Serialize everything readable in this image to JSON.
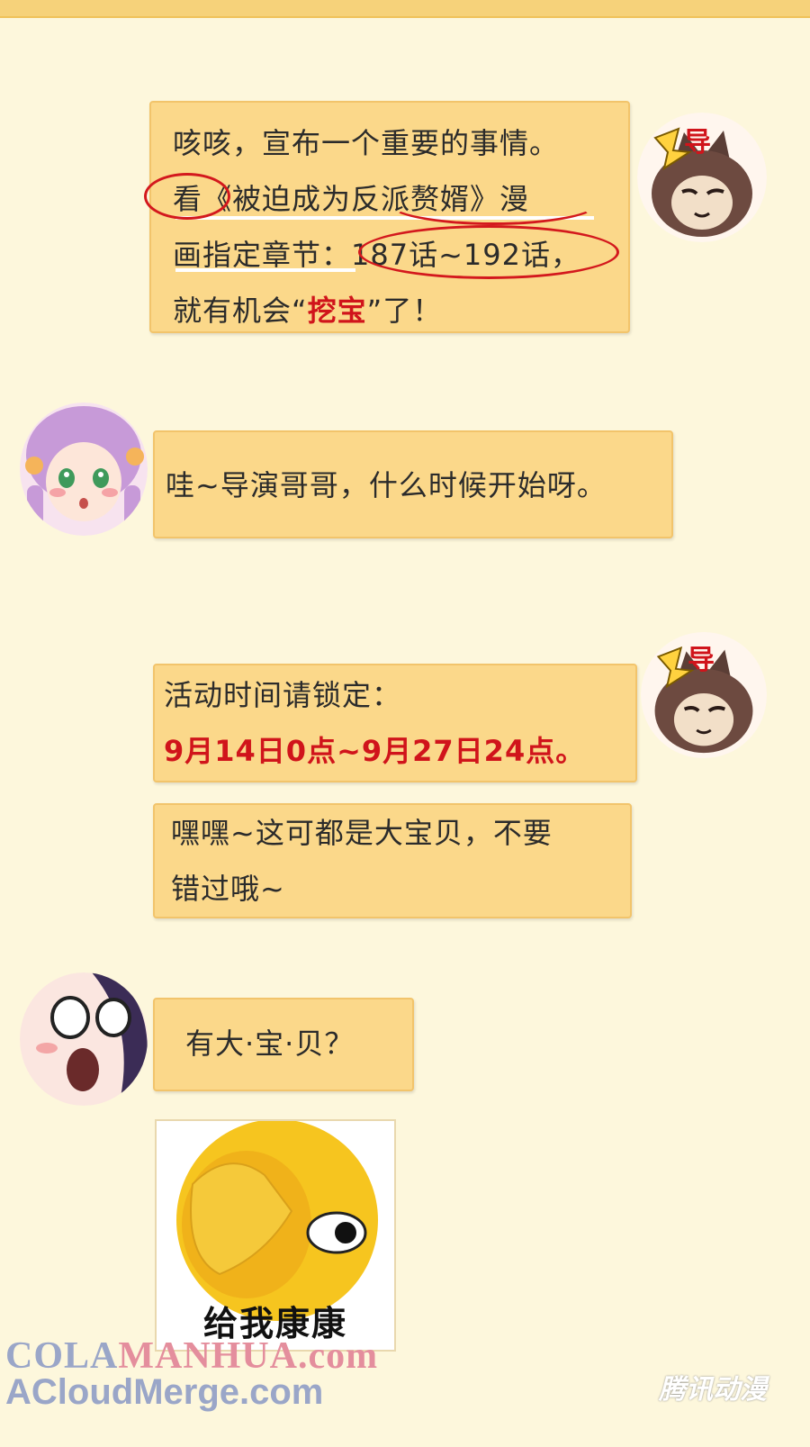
{
  "messages": [
    {
      "lines": [
        [
          {
            "t": "咳咳，宣布一个重要的事情。",
            "red": false
          }
        ],
        [
          {
            "t": "看《被迫成为反派赘婿》漫",
            "red": false
          }
        ],
        [
          {
            "t": "画指定章节：187话~192话，",
            "red": false
          }
        ],
        [
          {
            "t": "就有机会“",
            "red": false
          },
          {
            "t": "挖宝",
            "red": true
          },
          {
            "t": "”了！",
            "red": false
          }
        ]
      ]
    },
    {
      "lines": [
        [
          {
            "t": "哇~导演哥哥，什么时候开始呀。",
            "red": false
          }
        ]
      ]
    },
    {
      "lines": [
        [
          {
            "t": "活动时间请锁定：",
            "red": false
          }
        ],
        [
          {
            "t": "9月14日0点~9月27日24点。",
            "red": true
          }
        ]
      ]
    },
    {
      "lines": [
        [
          {
            "t": "嘿嘿~这可都是大宝贝，不要",
            "red": false
          }
        ],
        [
          {
            "t": "错过哦~",
            "red": false
          }
        ]
      ]
    },
    {
      "lines": [
        [
          {
            "t": "有大·宝·贝？",
            "red": false
          }
        ]
      ]
    }
  ],
  "avatars": {
    "director_badge": "导",
    "director_icon": "cat-avatar-icon",
    "girl_icon": "pink-hair-girl-avatar-icon",
    "shocked_icon": "shocked-face-avatar-icon"
  },
  "sticker": {
    "caption": "给我康康",
    "icon": "face-palm-emoji-icon"
  },
  "watermarks": {
    "line1_a": "COLA",
    "line1_b": "MANHUA.com",
    "line2": "ACloudMerge.com",
    "corner": "腾讯动漫"
  },
  "colors": {
    "background": "#fdf7dc",
    "bubble": "#fbd88a",
    "highlight_red": "#d0141b"
  }
}
